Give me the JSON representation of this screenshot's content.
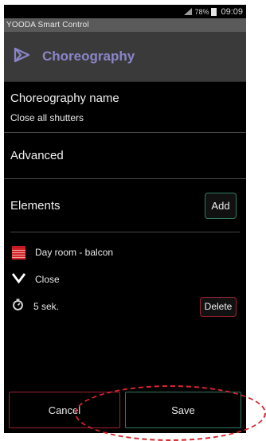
{
  "status_bar": {
    "battery": "78%",
    "time": "09:09"
  },
  "app": {
    "title": "YOODA Smart Control"
  },
  "header": {
    "title": "Choreography"
  },
  "form": {
    "name_label": "Choreography name",
    "name_value": "Close all shutters",
    "advanced_label": "Advanced",
    "elements_label": "Elements",
    "add_label": "Add"
  },
  "elements": [
    {
      "icon": "shutter-icon",
      "label": "Day room - balcon"
    },
    {
      "icon": "chevron-down-icon",
      "label": "Close"
    },
    {
      "icon": "timer-icon",
      "label": "5  sek."
    }
  ],
  "delete_label": "Delete",
  "footer": {
    "cancel_label": "Cancel",
    "save_label": "Save"
  },
  "colors": {
    "accent_purple": "#8a85c9",
    "green_outline": "#2f7a63",
    "red_outline": "#9a2430",
    "highlight_red": "#d9262d"
  }
}
